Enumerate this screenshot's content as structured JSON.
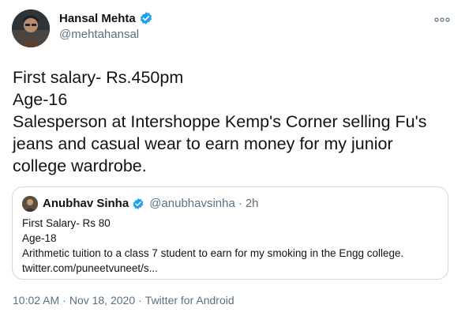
{
  "author": {
    "name": "Hansal Mehta",
    "handle": "@mehtahansal",
    "verified_icon": "verified-badge-icon",
    "avatar_icon": "avatar"
  },
  "menu_icon": "more-options-icon",
  "tweet": {
    "lines": [
      "First salary- Rs.450pm",
      "Age-16",
      "Salesperson at Intershoppe Kemp's Corner selling Fu's",
      "jeans and casual wear to earn money for my junior",
      "college wardrobe."
    ]
  },
  "quoted": {
    "name": "Anubhav Sinha",
    "handle": "@anubhavsinha",
    "separator": "·",
    "time": "2h",
    "lines": [
      "First Salary- Rs 80",
      "Age-18",
      "Arithmetic tuition to a class 7 student to earn for my smoking in the Engg college.",
      "twitter.com/puneetvuneet/s..."
    ]
  },
  "meta": {
    "time": "10:02 AM",
    "separator": "·",
    "date": "Nov 18, 2020",
    "source": "Twitter for Android"
  },
  "colors": {
    "verified": "#1da1f2",
    "secondary_text": "#5b7083",
    "border": "#cfd9de"
  }
}
